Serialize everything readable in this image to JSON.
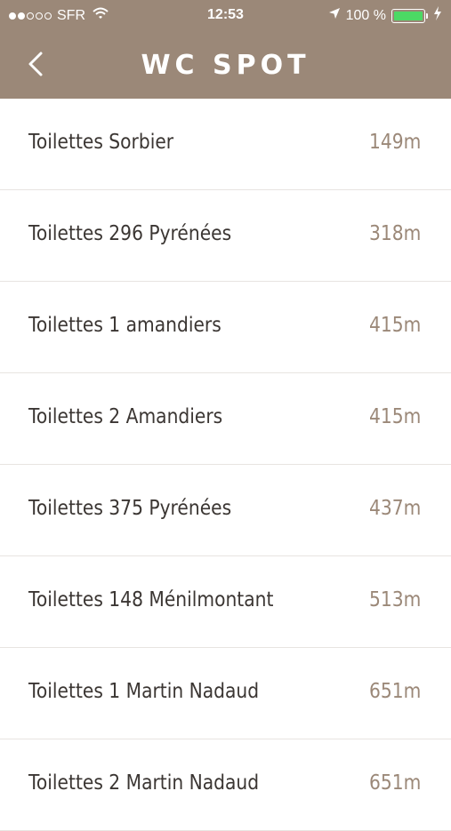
{
  "status_bar": {
    "carrier": "SFR",
    "time": "12:53",
    "battery": "100 %",
    "battery_level": 1.0,
    "signal_bars_filled": 2,
    "signal_bars_total": 5
  },
  "navbar": {
    "title": "WC SPOT",
    "back_icon": "chevron-left-icon"
  },
  "colors": {
    "accent": "#9b8878",
    "text": "#3b3633",
    "battery": "#4cd964"
  },
  "list": {
    "items": [
      {
        "name": "Toilettes Sorbier",
        "distance": "149m"
      },
      {
        "name": "Toilettes 296 Pyrénées",
        "distance": "318m"
      },
      {
        "name": "Toilettes 1 amandiers",
        "distance": "415m"
      },
      {
        "name": "Toilettes 2 Amandiers",
        "distance": "415m"
      },
      {
        "name": "Toilettes 375 Pyrénées",
        "distance": "437m"
      },
      {
        "name": "Toilettes 148 Ménilmontant",
        "distance": "513m"
      },
      {
        "name": "Toilettes 1 Martin Nadaud",
        "distance": "651m"
      },
      {
        "name": "Toilettes 2 Martin Nadaud",
        "distance": "651m"
      }
    ]
  }
}
